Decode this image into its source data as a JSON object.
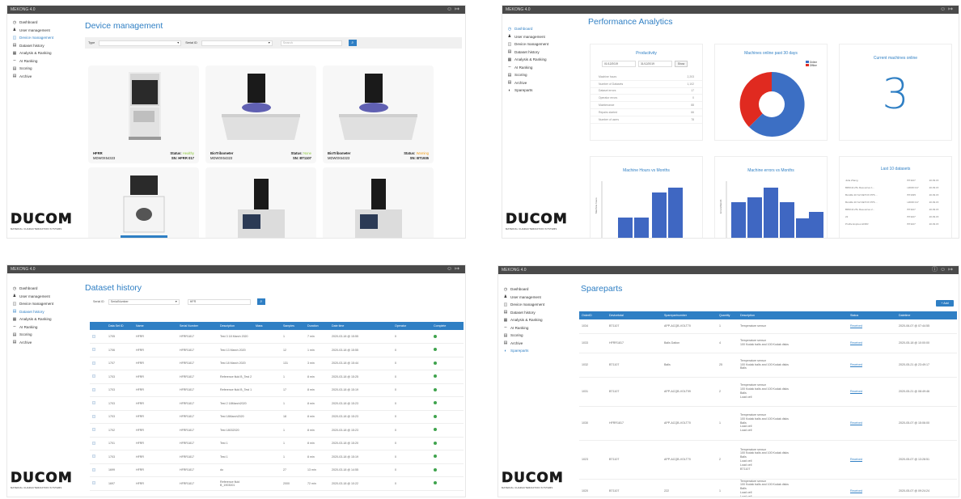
{
  "app_title": "MEKONG 4.0",
  "sidebar": {
    "items": [
      {
        "label": "Dashboard",
        "icon": "dashboard-icon"
      },
      {
        "label": "User management",
        "icon": "users-icon"
      },
      {
        "label": "Device management",
        "icon": "device-icon"
      },
      {
        "label": "Dataset history",
        "icon": "history-icon"
      },
      {
        "label": "Analysis & Ranking",
        "icon": "analysis-icon"
      },
      {
        "label": "AI Ranking",
        "icon": "ai-icon"
      },
      {
        "label": "Scoring",
        "icon": "scoring-icon"
      },
      {
        "label": "Archive",
        "icon": "archive-icon"
      },
      {
        "label": "Spareparts",
        "icon": "spareparts-icon"
      }
    ]
  },
  "logo": {
    "word": "DUCOM",
    "tagline": "MATERIAL CHARACTERIZATION SYSTEMS"
  },
  "device_management": {
    "title": "Device management",
    "filter_type_label": "Type",
    "filter_serial_label": "Serial ID",
    "search_placeholder": "Search",
    "cards": [
      {
        "name": "HFRR",
        "serial": "MDW0X54323",
        "status_label": "Status:",
        "status": "Healthy",
        "status_color": "#8dc63f",
        "sn": "SN: HFRR 017"
      },
      {
        "name": "BioTribometer",
        "serial": "MDW0X54323",
        "status_label": "Status:",
        "status": "None",
        "status_color": "#8dc63f",
        "sn": "SN: BT1107"
      },
      {
        "name": "BioTribometer",
        "serial": "MDW0X54323",
        "status_label": "Status:",
        "status": "Warning",
        "status_color": "#f0a020",
        "sn": "SN: BT1935"
      }
    ]
  },
  "performance": {
    "title": "Performance Analytics",
    "productivity": {
      "title": "Productivity",
      "from": "01/12/2019",
      "to": "31/12/2019",
      "button": "Show",
      "rows": [
        {
          "label": "Machine hours",
          "value": "2,203"
        },
        {
          "label": "Number of Datasets",
          "value": "1,102"
        },
        {
          "label": "Dataset errors",
          "value": "17"
        },
        {
          "label": "Operator errors",
          "value": "0"
        },
        {
          "label": "Maintenance",
          "value": "88"
        },
        {
          "label": "Repairs started",
          "value": "66"
        },
        {
          "label": "Number of users",
          "value": "78"
        }
      ]
    },
    "online": {
      "title": "Machines online past 30 days",
      "legend": [
        "Online",
        "Offline"
      ],
      "colors": [
        "#3c6fc4",
        "#e02a20"
      ]
    },
    "current": {
      "title": "Current machines online",
      "value": "3"
    },
    "hours_chart": {
      "title": "Machine Hours vs Months",
      "ylabel": "Machine hours"
    },
    "errors_chart": {
      "title": "Machine errors vs Months",
      "ylabel": "Errors/Month"
    },
    "last_datasets": {
      "title": "Last 10 datasets",
      "rows": [
        [
          "Julia Zhang",
          "BT1107",
          "20.09.15"
        ],
        [
          "BRNNA 25x Resources 1...",
          "HFRR 017",
          "20.09.15"
        ],
        [
          "BLAZE 41712 DETOX PPS ...",
          "BT1935",
          "20.09.15"
        ],
        [
          "BLAZE 41712 DETOX PPS ...",
          "HFRR 017",
          "20.09.15"
        ],
        [
          "BRNNA 25x Resources 2...",
          "BT1107",
          "20.09.15"
        ],
        [
          "22",
          "BT1107",
          "20.09.15"
        ],
        [
          "Profile Expires HFRR",
          "BT1107",
          "20.09.15"
        ]
      ]
    }
  },
  "dataset_history": {
    "title": "Dataset history",
    "filter_label": "Serial ID",
    "filter_value": "SerialNumber",
    "search_value": "HFR",
    "columns": [
      "",
      "Data Set ID",
      "Name",
      "Serial Number",
      "Description",
      "Mass",
      "Samples",
      "Duration",
      "Date time",
      "Operator",
      "Complete"
    ],
    "rows": [
      [
        "1705",
        "HFRR",
        "HFRR1817",
        "Test 3 18 March 2020",
        "",
        "1",
        "7 min",
        "2020-03-18 @ 15:55",
        "0"
      ],
      [
        "1706",
        "HFRR",
        "HFRR1817",
        "Test 13 March 2020",
        "",
        "12",
        "1 min",
        "2020-03-18 @ 15:55",
        "0"
      ],
      [
        "1707",
        "HFRR",
        "HFRR1817",
        "Test 18 March 2020",
        "",
        "131",
        "3 min",
        "2020-03-18 @ 15:44",
        "0"
      ],
      [
        "1703",
        "HFRR",
        "HFRR1817",
        "Reference fluid B_Test 2",
        "",
        "1",
        "8 min",
        "2020-03-18 @ 15:25",
        "0"
      ],
      [
        "1703",
        "HFRR",
        "HFRR1817",
        "Reference fluid B_Test 1",
        "",
        "17",
        "8 min",
        "2020-03-18 @ 15:19",
        "0"
      ],
      [
        "1703",
        "HFRR",
        "HFRR1817",
        "Test 2 18March2020",
        "",
        "1",
        "8 min",
        "2020-03-18 @ 15:23",
        "0"
      ],
      [
        "1703",
        "HFRR",
        "HFRR1817",
        "Test 18March2020",
        "",
        "18",
        "8 min",
        "2020-03-18 @ 15:23",
        "0"
      ],
      [
        "1702",
        "HFRR",
        "HFRR1817",
        "Test 18032020",
        "",
        "1",
        "8 min",
        "2020-03-18 @ 15:23",
        "0"
      ],
      [
        "1701",
        "HFRR",
        "HFRR1817",
        "Test 1",
        "",
        "1",
        "8 min",
        "2020-03-18 @ 15:20",
        "0"
      ],
      [
        "1703",
        "HFRR",
        "HFRR1817",
        "Test 1",
        "",
        "1",
        "8 min",
        "2020-03-18 @ 15:19",
        "0"
      ],
      [
        "1699",
        "HFRR",
        "HFRR1817",
        "do",
        "",
        "27",
        "13 min",
        "2020-03-18 @ 14:55",
        "0"
      ],
      [
        "1697",
        "HFRR",
        "HFRR1817",
        "Reference fluid B_1903001",
        "",
        "2000",
        "72 min",
        "2020-03-18 @ 10:22",
        "0"
      ]
    ]
  },
  "spareparts": {
    "title": "Spareparts",
    "add_button": "+ Add",
    "columns": [
      "OrderID",
      "Devicetotal",
      "Sparepartnumber",
      "Quantity",
      "Description",
      "Status",
      "Datetime"
    ],
    "rows": [
      [
        "1034",
        "BT1107",
        "APP-ACQB-VOLT70",
        "1",
        [
          "Temperature sensor"
        ],
        "Received",
        "2020-06-07 @ 07:44:55"
      ],
      [
        "1033",
        "HFRR1817",
        "Balls Dalton",
        "4",
        [
          "Temperature sensor",
          "100 Kodak balls and 100 Kodak disks"
        ],
        "Received",
        "2020-05-18 @ 10:00:00"
      ],
      [
        "1032",
        "BT1107",
        "Balls",
        "25",
        [
          "Temperature sensor",
          "100 Kodak balls and 100 Kodak disks",
          "Balls"
        ],
        "Received",
        "2020-05-21 @ 23:49:17"
      ],
      [
        "1031",
        "BT1107",
        "APP-ACQB-VOLT99",
        "2",
        [
          "Temperature sensor",
          "100 Kodak balls and 100 Kodak disks",
          "Balls",
          "Load cell"
        ],
        "Received",
        "2020-05-21 @ 08:49:46"
      ],
      [
        "1030",
        "HFRR1817",
        "APP-ACQB-VOLT70",
        "1",
        [
          "Temperature sensor",
          "100 Kodak balls and 100 Kodak disks",
          "Balls",
          "Load cell",
          "Load cell"
        ],
        "Received",
        "2020-05-07 @ 15:06:00"
      ],
      [
        "1023",
        "BT1107",
        "APP-ACQB-VOLT70",
        "2",
        [
          "Temperature sensor",
          "100 Kodak balls and 100 Kodak disks",
          "Balls",
          "Load cell",
          "Load cell",
          "BT1107"
        ],
        "Received",
        "2020-05-07 @ 13:28:51"
      ],
      [
        "1020",
        "BT1107",
        "222",
        "1",
        [
          "Temperature sensor",
          "100 Kodak balls and 100 Kodak disks",
          "Balls",
          "Load cell",
          "Load cell",
          "BT1107"
        ],
        "Received",
        "2020-05-07 @ 09:24:24"
      ]
    ]
  }
}
